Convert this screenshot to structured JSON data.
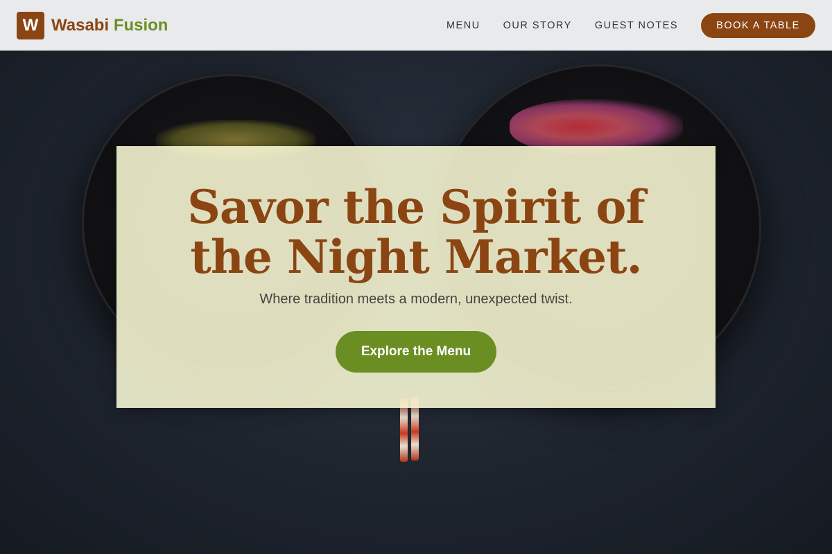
{
  "brand": {
    "logo_letter": "W",
    "name_part1": "Wasabi",
    "name_part2": "Fusion"
  },
  "nav": {
    "items": [
      {
        "label": "MENU"
      },
      {
        "label": "OUR STORY"
      },
      {
        "label": "GUEST NOTES"
      }
    ],
    "cta_label": "BOOK A TABLE"
  },
  "hero": {
    "title": "Savor the Spirit of the Night Market.",
    "subtitle": "Where tradition meets a modern, unexpected twist.",
    "cta_label": "Explore the Menu"
  },
  "colors": {
    "brand_brown": "#8b4513",
    "brand_green": "#6b8e23",
    "header_bg": "#e9eaeb",
    "card_bg": "#f5f5d2"
  }
}
